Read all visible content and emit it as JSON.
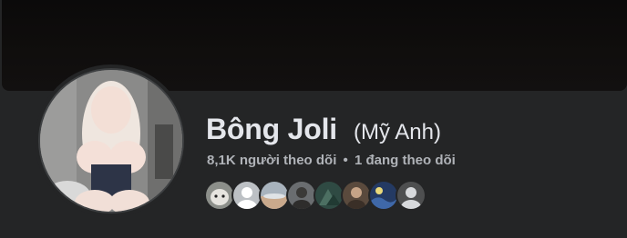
{
  "profile": {
    "name": "Bông Joli",
    "alternate_name": "(Mỹ Anh)",
    "followers": "8,1K người theo dõi",
    "separator": "•",
    "following": "1 đang theo dõi"
  },
  "friends": [
    {
      "avatar": "cat-photo"
    },
    {
      "avatar": "default-avatar"
    },
    {
      "avatar": "landscape-photo"
    },
    {
      "avatar": "person-photo"
    },
    {
      "avatar": "nature-photo"
    },
    {
      "avatar": "person-photo"
    },
    {
      "avatar": "night-sky-photo"
    },
    {
      "avatar": "default-avatar"
    }
  ],
  "colors": {
    "background": "#242526",
    "primary_text": "#e4e6eb",
    "secondary_text": "#b0b3b8",
    "cover": "#0f0d0c"
  }
}
